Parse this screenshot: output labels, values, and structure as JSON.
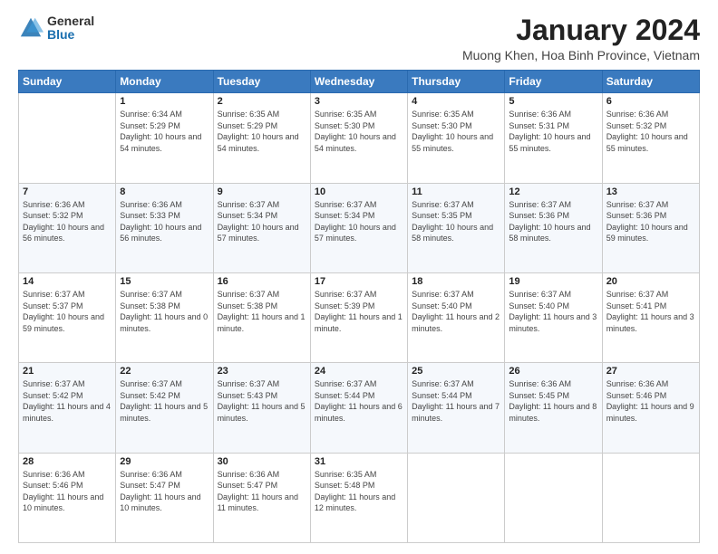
{
  "header": {
    "logo_general": "General",
    "logo_blue": "Blue",
    "month_title": "January 2024",
    "location": "Muong Khen, Hoa Binh Province, Vietnam"
  },
  "days_of_week": [
    "Sunday",
    "Monday",
    "Tuesday",
    "Wednesday",
    "Thursday",
    "Friday",
    "Saturday"
  ],
  "weeks": [
    [
      {
        "day": "",
        "sunrise": "",
        "sunset": "",
        "daylight": ""
      },
      {
        "day": "1",
        "sunrise": "Sunrise: 6:34 AM",
        "sunset": "Sunset: 5:29 PM",
        "daylight": "Daylight: 10 hours and 54 minutes."
      },
      {
        "day": "2",
        "sunrise": "Sunrise: 6:35 AM",
        "sunset": "Sunset: 5:29 PM",
        "daylight": "Daylight: 10 hours and 54 minutes."
      },
      {
        "day": "3",
        "sunrise": "Sunrise: 6:35 AM",
        "sunset": "Sunset: 5:30 PM",
        "daylight": "Daylight: 10 hours and 54 minutes."
      },
      {
        "day": "4",
        "sunrise": "Sunrise: 6:35 AM",
        "sunset": "Sunset: 5:30 PM",
        "daylight": "Daylight: 10 hours and 55 minutes."
      },
      {
        "day": "5",
        "sunrise": "Sunrise: 6:36 AM",
        "sunset": "Sunset: 5:31 PM",
        "daylight": "Daylight: 10 hours and 55 minutes."
      },
      {
        "day": "6",
        "sunrise": "Sunrise: 6:36 AM",
        "sunset": "Sunset: 5:32 PM",
        "daylight": "Daylight: 10 hours and 55 minutes."
      }
    ],
    [
      {
        "day": "7",
        "sunrise": "Sunrise: 6:36 AM",
        "sunset": "Sunset: 5:32 PM",
        "daylight": "Daylight: 10 hours and 56 minutes."
      },
      {
        "day": "8",
        "sunrise": "Sunrise: 6:36 AM",
        "sunset": "Sunset: 5:33 PM",
        "daylight": "Daylight: 10 hours and 56 minutes."
      },
      {
        "day": "9",
        "sunrise": "Sunrise: 6:37 AM",
        "sunset": "Sunset: 5:34 PM",
        "daylight": "Daylight: 10 hours and 57 minutes."
      },
      {
        "day": "10",
        "sunrise": "Sunrise: 6:37 AM",
        "sunset": "Sunset: 5:34 PM",
        "daylight": "Daylight: 10 hours and 57 minutes."
      },
      {
        "day": "11",
        "sunrise": "Sunrise: 6:37 AM",
        "sunset": "Sunset: 5:35 PM",
        "daylight": "Daylight: 10 hours and 58 minutes."
      },
      {
        "day": "12",
        "sunrise": "Sunrise: 6:37 AM",
        "sunset": "Sunset: 5:36 PM",
        "daylight": "Daylight: 10 hours and 58 minutes."
      },
      {
        "day": "13",
        "sunrise": "Sunrise: 6:37 AM",
        "sunset": "Sunset: 5:36 PM",
        "daylight": "Daylight: 10 hours and 59 minutes."
      }
    ],
    [
      {
        "day": "14",
        "sunrise": "Sunrise: 6:37 AM",
        "sunset": "Sunset: 5:37 PM",
        "daylight": "Daylight: 10 hours and 59 minutes."
      },
      {
        "day": "15",
        "sunrise": "Sunrise: 6:37 AM",
        "sunset": "Sunset: 5:38 PM",
        "daylight": "Daylight: 11 hours and 0 minutes."
      },
      {
        "day": "16",
        "sunrise": "Sunrise: 6:37 AM",
        "sunset": "Sunset: 5:38 PM",
        "daylight": "Daylight: 11 hours and 1 minute."
      },
      {
        "day": "17",
        "sunrise": "Sunrise: 6:37 AM",
        "sunset": "Sunset: 5:39 PM",
        "daylight": "Daylight: 11 hours and 1 minute."
      },
      {
        "day": "18",
        "sunrise": "Sunrise: 6:37 AM",
        "sunset": "Sunset: 5:40 PM",
        "daylight": "Daylight: 11 hours and 2 minutes."
      },
      {
        "day": "19",
        "sunrise": "Sunrise: 6:37 AM",
        "sunset": "Sunset: 5:40 PM",
        "daylight": "Daylight: 11 hours and 3 minutes."
      },
      {
        "day": "20",
        "sunrise": "Sunrise: 6:37 AM",
        "sunset": "Sunset: 5:41 PM",
        "daylight": "Daylight: 11 hours and 3 minutes."
      }
    ],
    [
      {
        "day": "21",
        "sunrise": "Sunrise: 6:37 AM",
        "sunset": "Sunset: 5:42 PM",
        "daylight": "Daylight: 11 hours and 4 minutes."
      },
      {
        "day": "22",
        "sunrise": "Sunrise: 6:37 AM",
        "sunset": "Sunset: 5:42 PM",
        "daylight": "Daylight: 11 hours and 5 minutes."
      },
      {
        "day": "23",
        "sunrise": "Sunrise: 6:37 AM",
        "sunset": "Sunset: 5:43 PM",
        "daylight": "Daylight: 11 hours and 5 minutes."
      },
      {
        "day": "24",
        "sunrise": "Sunrise: 6:37 AM",
        "sunset": "Sunset: 5:44 PM",
        "daylight": "Daylight: 11 hours and 6 minutes."
      },
      {
        "day": "25",
        "sunrise": "Sunrise: 6:37 AM",
        "sunset": "Sunset: 5:44 PM",
        "daylight": "Daylight: 11 hours and 7 minutes."
      },
      {
        "day": "26",
        "sunrise": "Sunrise: 6:36 AM",
        "sunset": "Sunset: 5:45 PM",
        "daylight": "Daylight: 11 hours and 8 minutes."
      },
      {
        "day": "27",
        "sunrise": "Sunrise: 6:36 AM",
        "sunset": "Sunset: 5:46 PM",
        "daylight": "Daylight: 11 hours and 9 minutes."
      }
    ],
    [
      {
        "day": "28",
        "sunrise": "Sunrise: 6:36 AM",
        "sunset": "Sunset: 5:46 PM",
        "daylight": "Daylight: 11 hours and 10 minutes."
      },
      {
        "day": "29",
        "sunrise": "Sunrise: 6:36 AM",
        "sunset": "Sunset: 5:47 PM",
        "daylight": "Daylight: 11 hours and 10 minutes."
      },
      {
        "day": "30",
        "sunrise": "Sunrise: 6:36 AM",
        "sunset": "Sunset: 5:47 PM",
        "daylight": "Daylight: 11 hours and 11 minutes."
      },
      {
        "day": "31",
        "sunrise": "Sunrise: 6:35 AM",
        "sunset": "Sunset: 5:48 PM",
        "daylight": "Daylight: 11 hours and 12 minutes."
      },
      {
        "day": "",
        "sunrise": "",
        "sunset": "",
        "daylight": ""
      },
      {
        "day": "",
        "sunrise": "",
        "sunset": "",
        "daylight": ""
      },
      {
        "day": "",
        "sunrise": "",
        "sunset": "",
        "daylight": ""
      }
    ]
  ]
}
